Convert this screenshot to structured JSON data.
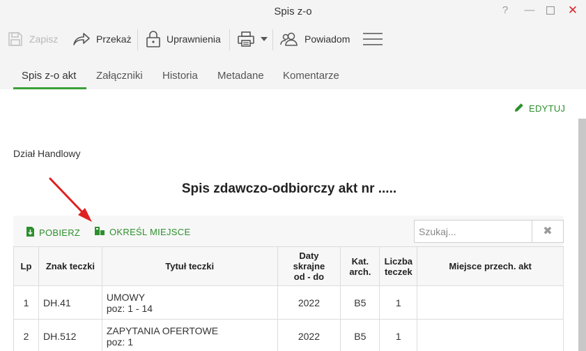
{
  "window": {
    "title": "Spis z-o"
  },
  "toolbar": {
    "save": "Zapisz",
    "forward": "Przekaż",
    "permissions": "Uprawnienia",
    "notify": "Powiadom"
  },
  "tabs": [
    "Spis z-o akt",
    "Załączniki",
    "Historia",
    "Metadane",
    "Komentarze"
  ],
  "edit": "EDYTUJ",
  "department": "Dział Handlowy",
  "doc_title": "Spis zdawczo-odbiorczy akt nr .....",
  "grid_toolbar": {
    "download": "POBIERZ",
    "set_location": "OKREŚL MIEJSCE",
    "search_placeholder": "Szukaj..."
  },
  "table": {
    "headers": {
      "lp": "Lp",
      "sign": "Znak teczki",
      "title": "Tytuł teczki",
      "dates_1": "Daty",
      "dates_2": "skrajne",
      "dates_3": "od - do",
      "cat_1": "Kat.",
      "cat_2": "arch.",
      "count_1": "Liczba",
      "count_2": "teczek",
      "place": "Miejsce przech. akt"
    },
    "rows": [
      {
        "lp": "1",
        "sign": "DH.41",
        "title": "UMOWY",
        "pos": "poz: 1 - 14",
        "dates": "2022",
        "cat": "B5",
        "count": "1",
        "place": ""
      },
      {
        "lp": "2",
        "sign": "DH.512",
        "title": "ZAPYTANIA OFERTOWE",
        "pos": "poz: 1",
        "dates": "2022",
        "cat": "B5",
        "count": "1",
        "place": ""
      }
    ]
  },
  "colors": {
    "accent": "#2d8f2d",
    "tab_underline": "#3aa13a",
    "annotation_arrow": "#e02020",
    "close": "#d9262b"
  }
}
